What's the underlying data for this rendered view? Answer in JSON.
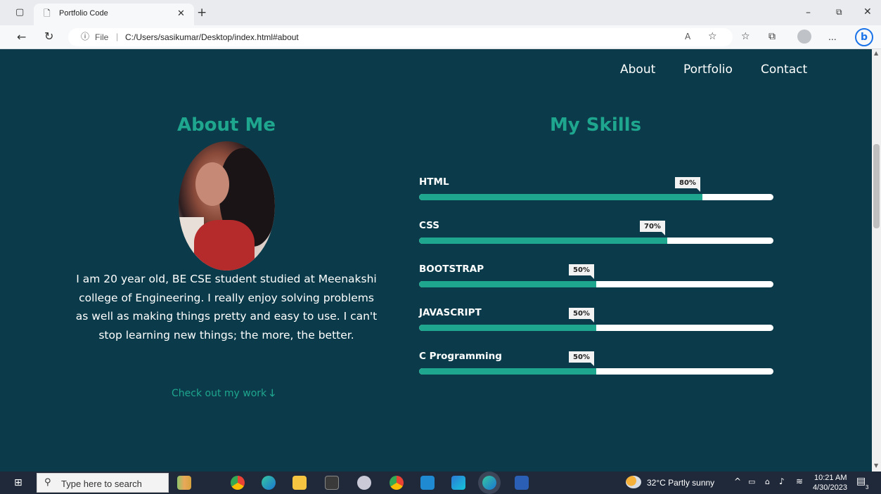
{
  "browser": {
    "tab_title": "Portfolio Code",
    "url_scheme_label": "File",
    "url": "C:/Users/sasikumar/Desktop/index.html#about",
    "more_label": "..."
  },
  "nav": {
    "items": [
      "About",
      "Portfolio",
      "Contact"
    ]
  },
  "about": {
    "heading": "About Me",
    "text": "I am 20 year old, BE CSE student studied at Meenakshi college of Engineering. I really enjoy solving problems as well as making things pretty and easy to use. I can't stop learning new things; the more, the better.",
    "link": "Check out my work",
    "link_icon": "arrow-down-icon"
  },
  "skills": {
    "heading": "My Skills",
    "items": [
      {
        "name": "HTML",
        "percent_label": "80%",
        "level": 0.8
      },
      {
        "name": "CSS",
        "percent_label": "70%",
        "level": 0.7
      },
      {
        "name": "BOOTSTRAP",
        "percent_label": "50%",
        "level": 0.5
      },
      {
        "name": "JAVASCRIPT",
        "percent_label": "50%",
        "level": 0.5
      },
      {
        "name": "C Programming",
        "percent_label": "50%",
        "level": 0.5
      }
    ]
  },
  "taskbar": {
    "search_placeholder": "Type here to search",
    "weather": "32°C  Partly sunny",
    "time": "10:21 AM",
    "date": "4/30/2023",
    "notification_count": "3"
  },
  "colors": {
    "page_bg": "#0b3b4a",
    "accent": "#1fa68e",
    "text": "#ffffff"
  }
}
